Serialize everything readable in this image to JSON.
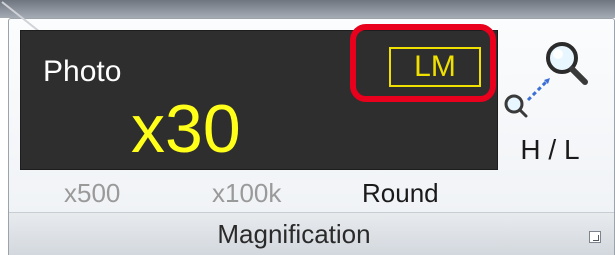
{
  "display": {
    "mode": "Photo",
    "badge": "LM",
    "magnification": "x30"
  },
  "options": {
    "x500": "x500",
    "x100k": "x100k",
    "round": "Round"
  },
  "tool": {
    "label": "H / L",
    "icon": "magnifier-zoom-icon"
  },
  "group": {
    "label": "Magnification",
    "launcher_icon": "dialog-launcher-icon"
  },
  "colors": {
    "display_bg": "#2e2e2e",
    "value_yellow": "#ffff1a",
    "badge_yellow": "#f0e000",
    "highlight_red": "#e8001c"
  }
}
